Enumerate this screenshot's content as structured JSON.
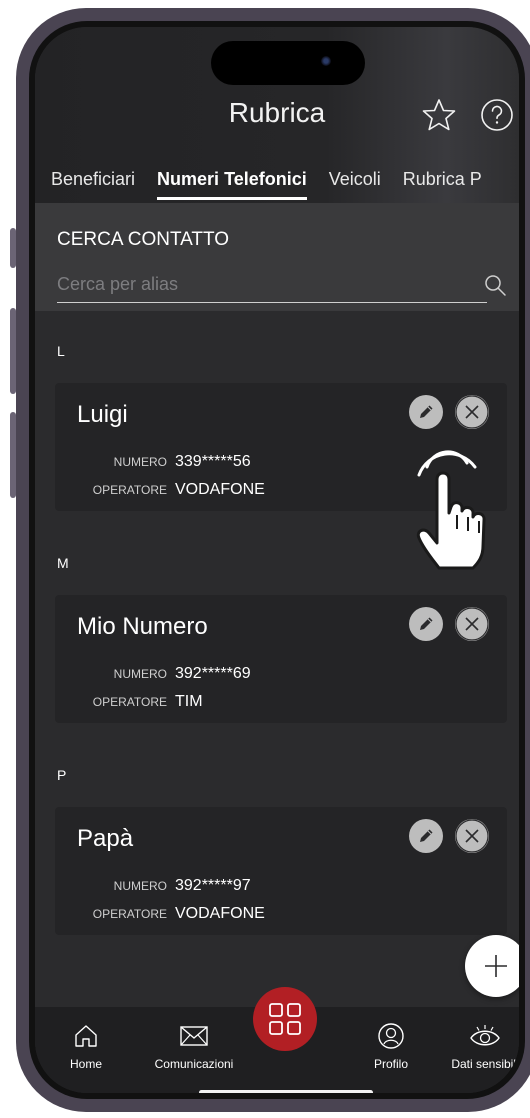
{
  "header": {
    "title": "Rubrica",
    "star_icon": "star-icon",
    "help_icon": "question-circle-icon"
  },
  "tabs": [
    {
      "label": "Beneficiari"
    },
    {
      "label": "Numeri Telefonici",
      "active": true
    },
    {
      "label": "Veicoli"
    },
    {
      "label": "Rubrica P"
    }
  ],
  "search": {
    "label": "CERCA CONTATTO",
    "placeholder": "Cerca per alias",
    "value": ""
  },
  "contacts": {
    "number_label": "NUMERO",
    "operator_label": "OPERATORE",
    "groups": [
      {
        "letter": "L",
        "name": "Luigi",
        "number": "339*****56",
        "operator": "VODAFONE"
      },
      {
        "letter": "M",
        "name": "Mio Numero",
        "number": "392*****69",
        "operator": "TIM"
      },
      {
        "letter": "P",
        "name": "Papà",
        "number": "392*****97",
        "operator": "VODAFONE"
      }
    ]
  },
  "fab": {
    "icon": "plus-icon"
  },
  "bottom_nav": {
    "items": [
      {
        "label": "Home",
        "icon": "home-icon"
      },
      {
        "label": "Comunicazioni",
        "icon": "envelope-icon"
      },
      {
        "label": "",
        "icon": "grid-icon"
      },
      {
        "label": "Profilo",
        "icon": "profile-icon"
      },
      {
        "label": "Dati sensibili",
        "icon": "eye-icon"
      }
    ]
  },
  "colors": {
    "background": "#2b2b2d",
    "accent": "#b21f24",
    "card": "#242426"
  }
}
